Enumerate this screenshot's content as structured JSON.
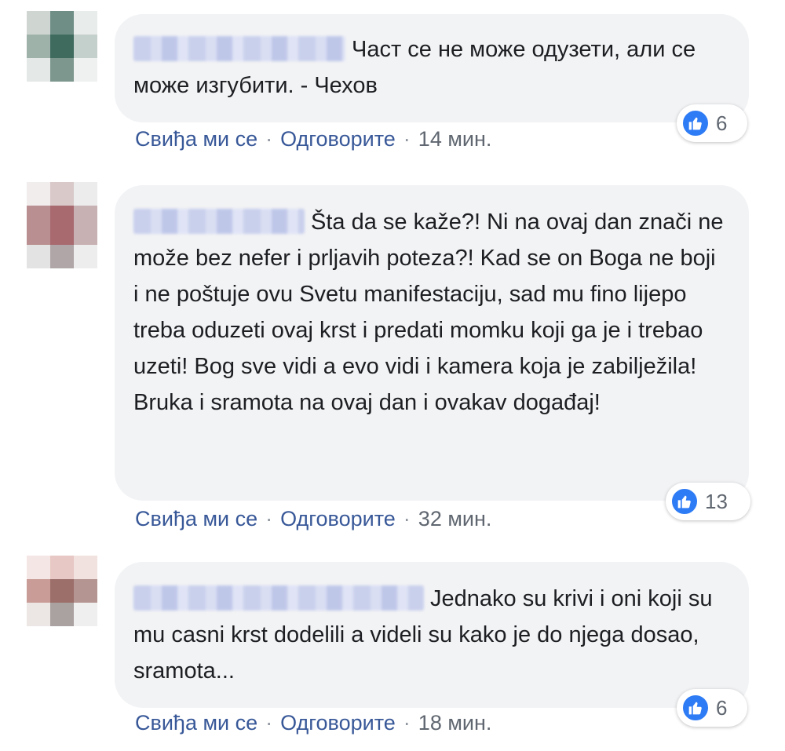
{
  "comments": [
    {
      "text": "Част се не може одузети, али се може изгубити. - Чехов",
      "reaction_count": "6",
      "like_label": "Свиђа ми се",
      "reply_label": "Одговорите",
      "time": "14 мин."
    },
    {
      "text": "Šta da se kaže?! Ni na ovaj dan znači ne može bez nefer i prljavih poteza?! Kad se on Boga ne boji i ne poštuje ovu Svetu manifestaciju, sad mu fino lijepo treba oduzeti ovaj krst i predati momku koji ga je i trebao uzeti! Bog sve vidi a evo vidi i kamera koja je zabilježila! Bruka i sramota na ovaj dan i ovakav događaj!",
      "reaction_count": "13",
      "like_label": "Свиђа ми се",
      "reply_label": "Одговорите",
      "time": "32 мин."
    },
    {
      "text": "Jednako su krivi i oni koji su mu casni krst dodelili a videli su kako je do njega dosao, sramota...",
      "reaction_count": "6",
      "like_label": "Свиђа ми се",
      "reply_label": "Одговорите",
      "time": "18 мин."
    }
  ],
  "icons": {
    "like": "thumbs-up-icon",
    "avatar": "blurred-avatar"
  },
  "colors": {
    "link": "#385898",
    "like_badge": "#2d7bf5",
    "bubble_bg": "#f2f3f5",
    "meta_text": "#606770"
  }
}
